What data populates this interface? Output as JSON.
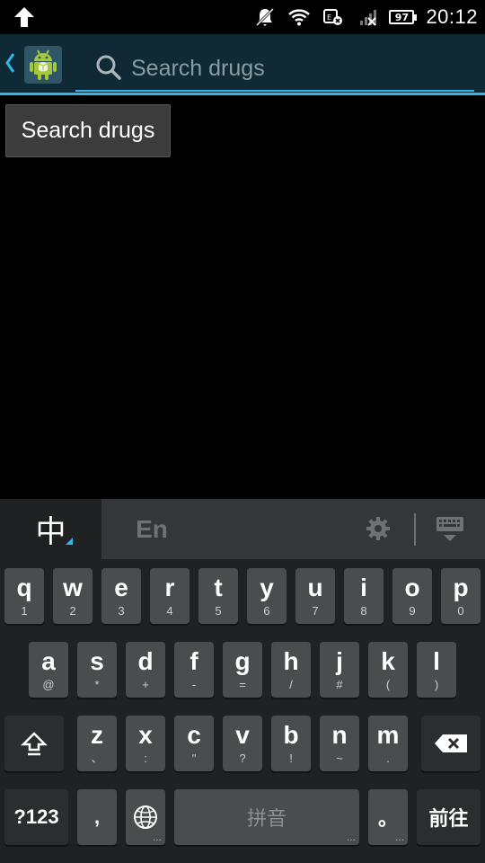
{
  "status_bar": {
    "time": "20:12",
    "battery": "97",
    "icons": [
      "upload-arrow-icon",
      "mute-icon",
      "wifi-icon",
      "notification-error-icon",
      "signal-icon"
    ]
  },
  "action_bar": {
    "app_icon": "android-robot-icon",
    "search_placeholder": "Search drugs"
  },
  "content": {
    "search_button_label": "Search drugs"
  },
  "keyboard": {
    "tab_zh": "中",
    "tab_en": "En",
    "row1": [
      {
        "main": "q",
        "sub": "1"
      },
      {
        "main": "w",
        "sub": "2"
      },
      {
        "main": "e",
        "sub": "3"
      },
      {
        "main": "r",
        "sub": "4"
      },
      {
        "main": "t",
        "sub": "5"
      },
      {
        "main": "y",
        "sub": "6"
      },
      {
        "main": "u",
        "sub": "7"
      },
      {
        "main": "i",
        "sub": "8"
      },
      {
        "main": "o",
        "sub": "9"
      },
      {
        "main": "p",
        "sub": "0"
      }
    ],
    "row2": [
      {
        "main": "a",
        "sub": "@"
      },
      {
        "main": "s",
        "sub": "*"
      },
      {
        "main": "d",
        "sub": "+"
      },
      {
        "main": "f",
        "sub": "-"
      },
      {
        "main": "g",
        "sub": "="
      },
      {
        "main": "h",
        "sub": "/"
      },
      {
        "main": "j",
        "sub": "#"
      },
      {
        "main": "k",
        "sub": "("
      },
      {
        "main": "l",
        "sub": ")"
      }
    ],
    "row3": [
      {
        "main": "z",
        "sub": "、"
      },
      {
        "main": "x",
        "sub": ":"
      },
      {
        "main": "c",
        "sub": "\""
      },
      {
        "main": "v",
        "sub": "?"
      },
      {
        "main": "b",
        "sub": "!"
      },
      {
        "main": "n",
        "sub": "~"
      },
      {
        "main": "m",
        "sub": "."
      }
    ],
    "symbols_label": "?123",
    "comma_label": ",",
    "space_label": "拼音",
    "period_label": "。",
    "enter_label": "前往",
    "more_mark": "..."
  },
  "colors": {
    "accent": "#33b5e5",
    "action_bar_bg": "#0f2a34",
    "key_bg": "#4a4c4f",
    "keyboard_bg": "#1f2123"
  }
}
